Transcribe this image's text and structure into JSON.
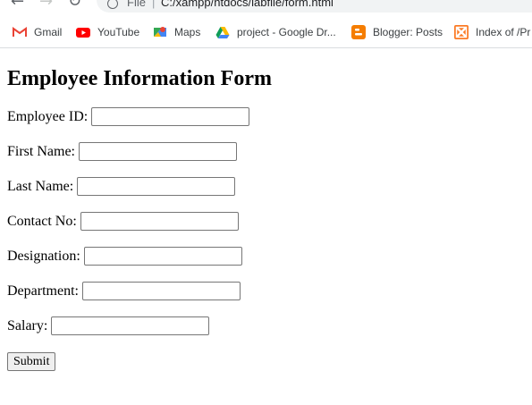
{
  "browser": {
    "omnibox": {
      "scheme_label": "File",
      "separator": "|",
      "url": "C:/xampp/htdocs/labfile/form.html"
    },
    "bookmarks": [
      {
        "label": "Gmail",
        "icon": "gmail-icon"
      },
      {
        "label": "YouTube",
        "icon": "youtube-icon"
      },
      {
        "label": "Maps",
        "icon": "maps-icon"
      },
      {
        "label": "project - Google Dr...",
        "icon": "google-drive-icon"
      },
      {
        "label": "Blogger: Posts",
        "icon": "blogger-icon"
      },
      {
        "label": "Index of /Pr",
        "icon": "xampp-icon"
      }
    ]
  },
  "form": {
    "title": "Employee Information Form",
    "fields": [
      {
        "label": "Employee ID:",
        "value": ""
      },
      {
        "label": "First Name:",
        "value": ""
      },
      {
        "label": "Last Name:",
        "value": ""
      },
      {
        "label": "Contact No:",
        "value": ""
      },
      {
        "label": "Designation:",
        "value": ""
      },
      {
        "label": "Department:",
        "value": ""
      },
      {
        "label": "Salary:",
        "value": ""
      }
    ],
    "submit_label": "Submit"
  }
}
